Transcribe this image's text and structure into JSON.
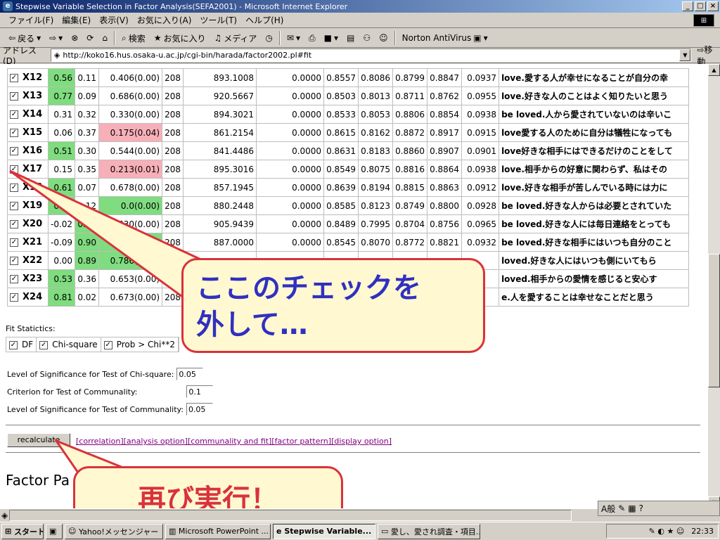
{
  "window": {
    "title": "Stepwise Variable Selection in Factor Analysis(SEFA2001) - Microsoft Internet Explorer",
    "min": "_",
    "max": "□",
    "close": "×"
  },
  "menu": [
    "ファイル(F)",
    "編集(E)",
    "表示(V)",
    "お気に入り(A)",
    "ツール(T)",
    "ヘルプ(H)"
  ],
  "toolbar": {
    "back": "戻る",
    "search": "検索",
    "favorites": "お気に入り",
    "media": "メディア",
    "norton": "Norton AntiVirus"
  },
  "address": {
    "label": "アドレス(D)",
    "url": "http://koko16.hus.osaka-u.ac.jp/cgi-bin/harada/factor2002.pl#fit",
    "go": "移動"
  },
  "rows": [
    {
      "var": "X12",
      "c1": "0.56",
      "c1c": "g",
      "c2": "0.11",
      "c3": "0.406(0.00)",
      "c3c": "",
      "df": "208",
      "chi": "893.1008",
      "p": "0.0000",
      "f1": "0.8557",
      "f2": "0.8086",
      "f3": "0.8799",
      "f4": "0.8847",
      "g": "0.0937",
      "text": "love.愛する人が幸せになることが自分の幸"
    },
    {
      "var": "X13",
      "c1": "0.77",
      "c1c": "g",
      "c2": "0.09",
      "c3": "0.686(0.00)",
      "c3c": "",
      "df": "208",
      "chi": "920.5667",
      "p": "0.0000",
      "f1": "0.8503",
      "f2": "0.8013",
      "f3": "0.8711",
      "f4": "0.8762",
      "g": "0.0955",
      "text": "love.好きな人のことはよく知りたいと思う"
    },
    {
      "var": "X14",
      "c1": "0.31",
      "c1c": "",
      "c2": "0.32",
      "c3": "0.330(0.00)",
      "c3c": "",
      "df": "208",
      "chi": "894.3021",
      "p": "0.0000",
      "f1": "0.8533",
      "f2": "0.8053",
      "f3": "0.8806",
      "f4": "0.8854",
      "g": "0.0938",
      "text": "be loved.人から愛されていないのは辛いこ"
    },
    {
      "var": "X15",
      "c1": "0.06",
      "c1c": "",
      "c2": "0.37",
      "c3": "0.175(0.04)",
      "c3c": "p",
      "df": "208",
      "chi": "861.2154",
      "p": "0.0000",
      "f1": "0.8615",
      "f2": "0.8162",
      "f3": "0.8872",
      "f4": "0.8917",
      "g": "0.0915",
      "text": "love愛する人のために自分は犠牲になっても"
    },
    {
      "var": "X16",
      "c1": "0.51",
      "c1c": "g",
      "c2": "0.30",
      "c3": "0.544(0.00)",
      "c3c": "",
      "df": "208",
      "chi": "841.4486",
      "p": "0.0000",
      "f1": "0.8631",
      "f2": "0.8183",
      "f3": "0.8860",
      "f4": "0.8907",
      "g": "0.0901",
      "text": "love好きな相手にはできるだけのことをして"
    },
    {
      "var": "X17",
      "c1": "0.15",
      "c1c": "",
      "c2": "0.35",
      "c3": "0.213(0.01)",
      "c3c": "p",
      "df": "208",
      "chi": "895.3016",
      "p": "0.0000",
      "f1": "0.8549",
      "f2": "0.8075",
      "f3": "0.8816",
      "f4": "0.8864",
      "g": "0.0938",
      "text": "love.相手からの好意に関わらず、私はその"
    },
    {
      "var": "X18",
      "c1": "0.61",
      "c1c": "g",
      "c2": "0.07",
      "c3": "0.678(0.00)",
      "c3c": "",
      "df": "208",
      "chi": "857.1945",
      "p": "0.0000",
      "f1": "0.8639",
      "f2": "0.8194",
      "f3": "0.8815",
      "f4": "0.8863",
      "g": "0.0912",
      "text": "love.好きな相手が苦しんでいる時には力に"
    },
    {
      "var": "X19",
      "c1": "0.81",
      "c1c": "g",
      "c2": "0.12",
      "c3": "0.0(0.00)",
      "c3c": "g",
      "df": "208",
      "chi": "880.2448",
      "p": "0.0000",
      "f1": "0.8585",
      "f2": "0.8123",
      "f3": "0.8749",
      "f4": "0.8800",
      "g": "0.0928",
      "text": "be loved.好きな人からは必要とされていた"
    },
    {
      "var": "X20",
      "c1": "-0.02",
      "c1c": "",
      "c2": "0.81",
      "c2c": "g",
      "c3": "0.630(0.00)",
      "c3c": "",
      "df": "208",
      "chi": "905.9439",
      "p": "0.0000",
      "f1": "0.8489",
      "f2": "0.7995",
      "f3": "0.8704",
      "f4": "0.8756",
      "g": "0.0965",
      "text": "be loved.好きな人には毎日連絡をとっても"
    },
    {
      "var": "X21",
      "c1": "-0.09",
      "c1c": "",
      "c2": "0.90",
      "c2c": "g",
      "c3": "0.707(0.00)",
      "c3c": "g",
      "df": "208",
      "chi": "887.0000",
      "p": "0.0000",
      "f1": "0.8545",
      "f2": "0.8070",
      "f3": "0.8772",
      "f4": "0.8821",
      "g": "0.0932",
      "text": "be loved.好きな相手にはいつも自分のこと"
    },
    {
      "var": "X22",
      "c1": "0.00",
      "c1c": "",
      "c2": "0.89",
      "c2c": "g",
      "c3": "0.786(0.00)",
      "c3c": "g",
      "df": "208",
      "chi": "",
      "p": "",
      "f1": "",
      "f2": "",
      "f3": "",
      "f4": "",
      "g": "",
      "text": "loved.好きな人にはいつも側にいてもら"
    },
    {
      "var": "X23",
      "c1": "0.53",
      "c1c": "g",
      "c2": "0.36",
      "c3": "0.653(0.00)",
      "c3c": "",
      "df": "208",
      "chi": "",
      "p": "",
      "f1": "",
      "f2": "",
      "f3": "",
      "f4": "",
      "g": "",
      "text": "loved.相手からの愛情を感じると安心す"
    },
    {
      "var": "X24",
      "c1": "0.81",
      "c1c": "g",
      "c2": "0.02",
      "c3": "0.673(0.00)",
      "c3c": "",
      "df": "208",
      "chi": "",
      "p": "",
      "f1": "",
      "f2": "",
      "f3": "",
      "f4": "",
      "g": "",
      "text": "e.人を愛することは幸せなことだと思う"
    }
  ],
  "fit": {
    "label": "Fit Statictics:",
    "items": [
      "DF",
      "Chi-square",
      "Prob > Chi**2"
    ]
  },
  "params": [
    {
      "label": "Level of Significance for Test of Chi-square:",
      "value": "0.05"
    },
    {
      "label": "Criterion for Test of Communality:",
      "value": "0.1"
    },
    {
      "label": "Level of Significance for Test of Communality:",
      "value": "0.05"
    }
  ],
  "recalculate": "recalculate",
  "links": "[correlation][analysis option][communality and fit][factor pattern][display option]",
  "factor_heading": "Factor Pa",
  "callouts": {
    "top": [
      "ここのチェックを",
      "外して…"
    ],
    "bottom": "再び実行！"
  },
  "taskbar": {
    "start": "スタート",
    "items": [
      "Yahoo!メッセンジャー",
      "Microsoft PowerPoint ...",
      "Stepwise Variable...",
      "愛し、愛され調査・項目..."
    ],
    "clock": "22:33"
  },
  "ime": "A般",
  "colors": {
    "green": "#7fdc7f",
    "pink": "#f7b0b8",
    "callout_border": "#d9323c",
    "callout_text": "#3030c0"
  }
}
